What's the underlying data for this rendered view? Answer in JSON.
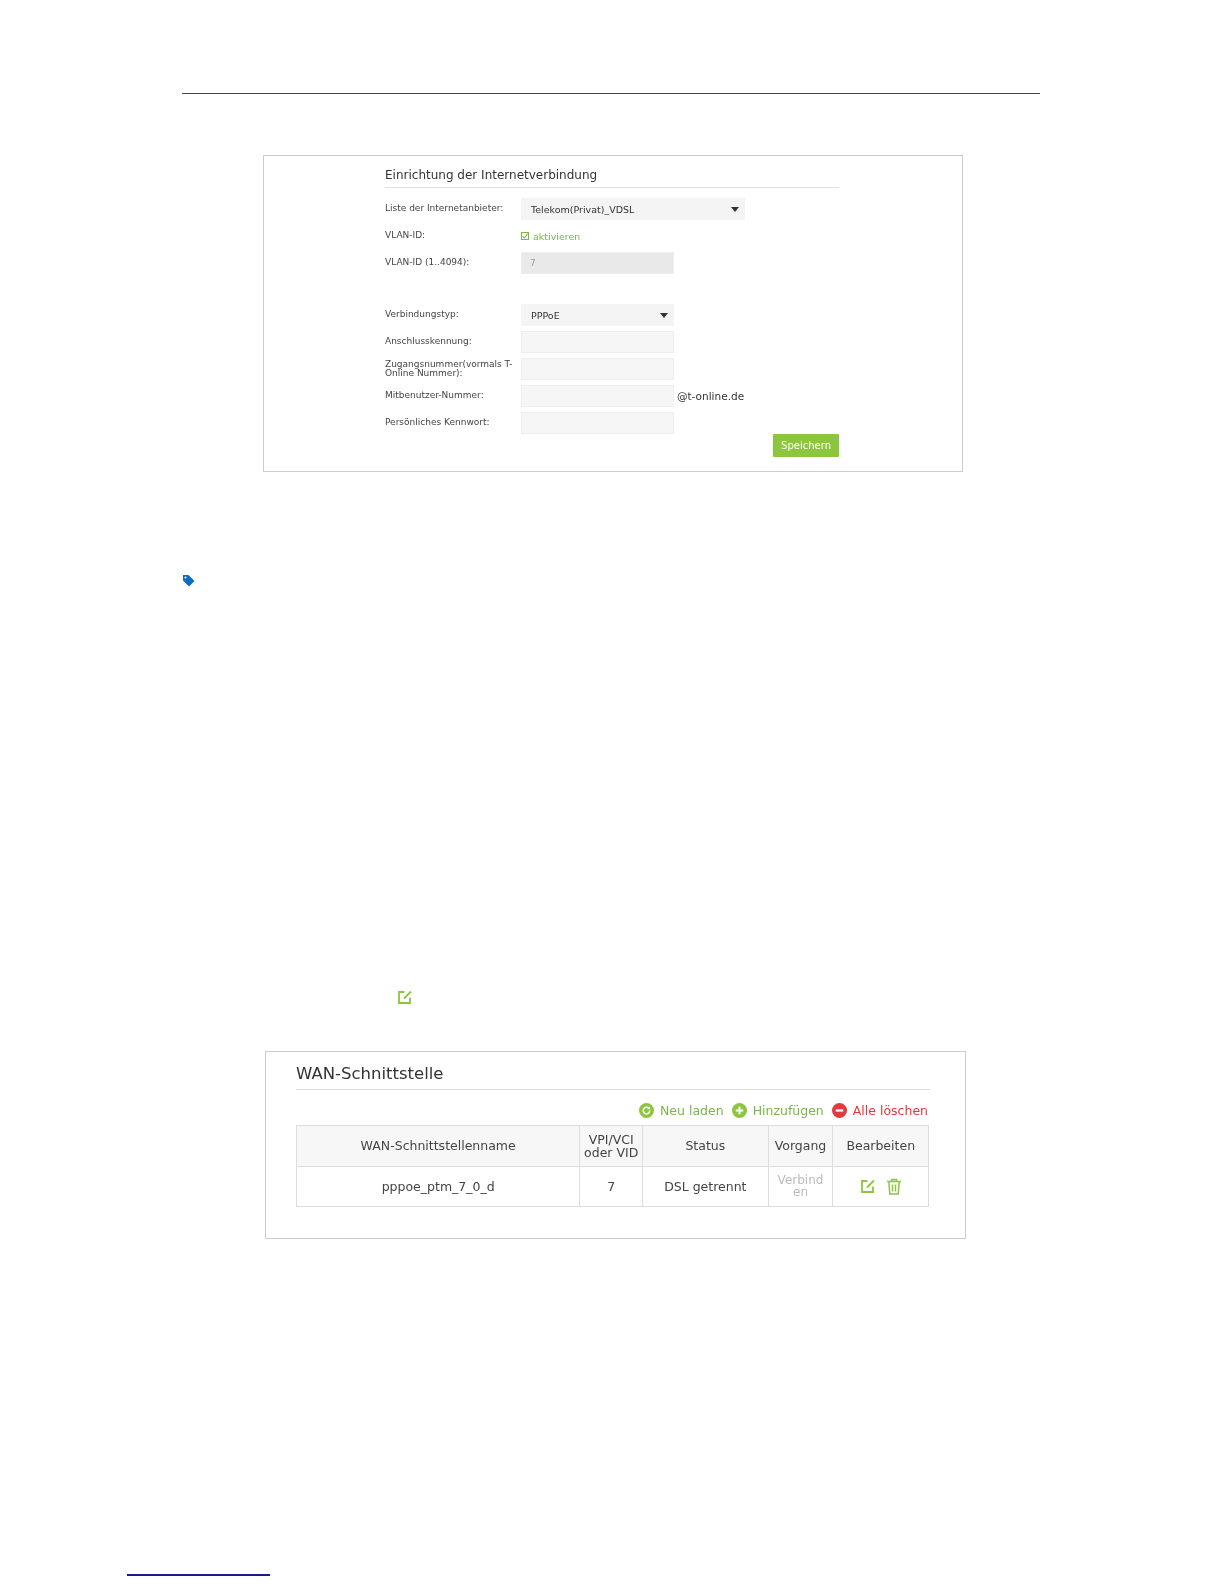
{
  "internet_setup": {
    "title": "Einrichtung der Internetverbindung",
    "rows": [
      {
        "kind": "select",
        "label": "Liste der Internetanbieter:",
        "value": "Telekom(Privat)_VDSL",
        "wide": true
      },
      {
        "kind": "checkbox",
        "label": "VLAN-ID:",
        "option": "aktivieren",
        "checked": true
      },
      {
        "kind": "input",
        "label": "VLAN-ID (1..4094):",
        "value": "7",
        "disabled": true
      },
      {
        "kind": "spacer"
      },
      {
        "kind": "select",
        "label": "Verbindungstyp:",
        "value": "PPPoE",
        "wide": false
      },
      {
        "kind": "input",
        "label": "Anschlusskennung:",
        "disabled": false
      },
      {
        "kind": "input",
        "label": "Zugangsnummer(vormals T-Online Nummer):",
        "disabled": false
      },
      {
        "kind": "input",
        "label": "Mitbenutzer-Nummer:",
        "suffix": "@t-online.de",
        "disabled": false
      },
      {
        "kind": "input",
        "label": "Persönliches Kennwort:",
        "disabled": false
      }
    ],
    "save_button": "Speichern"
  },
  "wan_interface": {
    "title": "WAN-Schnittstelle",
    "actions": [
      {
        "kind": "reload",
        "label": "Neu laden"
      },
      {
        "kind": "add",
        "label": "Hinzufügen"
      },
      {
        "kind": "delete",
        "label": "Alle löschen"
      }
    ],
    "columns": [
      "WAN-Schnittstellenname",
      "VPI/VCI oder VID",
      "Status",
      "Vorgang",
      "Bearbeiten"
    ],
    "rows": [
      {
        "name": "pppoe_ptm_7_0_d",
        "vid": "7",
        "status": "DSL getrennt",
        "action": "Verbinden",
        "action_disabled": true
      }
    ]
  }
}
